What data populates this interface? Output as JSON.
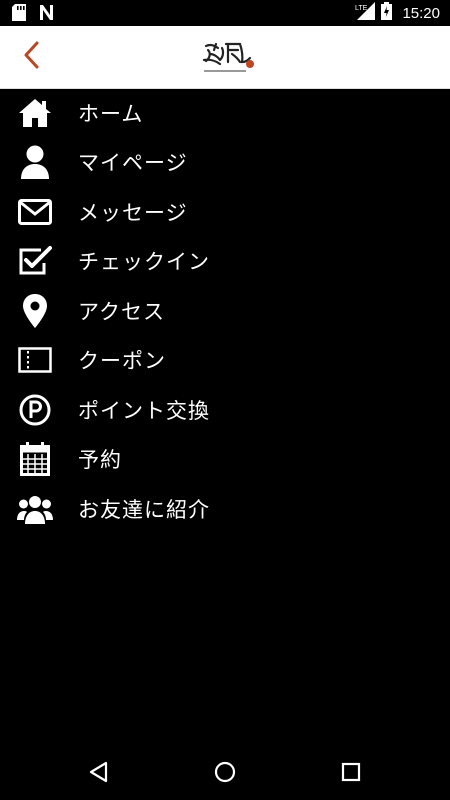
{
  "status_bar": {
    "time": "15:20",
    "network": "LTE",
    "icons": [
      "sd-card-icon",
      "n-app-icon",
      "lte-signal-icon",
      "battery-charging-icon"
    ]
  },
  "header": {
    "back_icon": "chevron-left-icon",
    "accent_color": "#c0441f",
    "logo": "brand-logo"
  },
  "menu": {
    "items": [
      {
        "label": "ホーム",
        "icon": "home-icon"
      },
      {
        "label": "マイページ",
        "icon": "user-icon"
      },
      {
        "label": "メッセージ",
        "icon": "envelope-icon"
      },
      {
        "label": "チェックイン",
        "icon": "checkbox-icon"
      },
      {
        "label": "アクセス",
        "icon": "map-pin-icon"
      },
      {
        "label": "クーポン",
        "icon": "ticket-icon"
      },
      {
        "label": "ポイント交換",
        "icon": "points-icon"
      },
      {
        "label": "予約",
        "icon": "calendar-icon"
      },
      {
        "label": "お友達に紹介",
        "icon": "users-icon"
      }
    ]
  },
  "nav_bar": {
    "buttons": [
      "back-triangle-icon",
      "home-circle-icon",
      "recents-square-icon"
    ]
  }
}
